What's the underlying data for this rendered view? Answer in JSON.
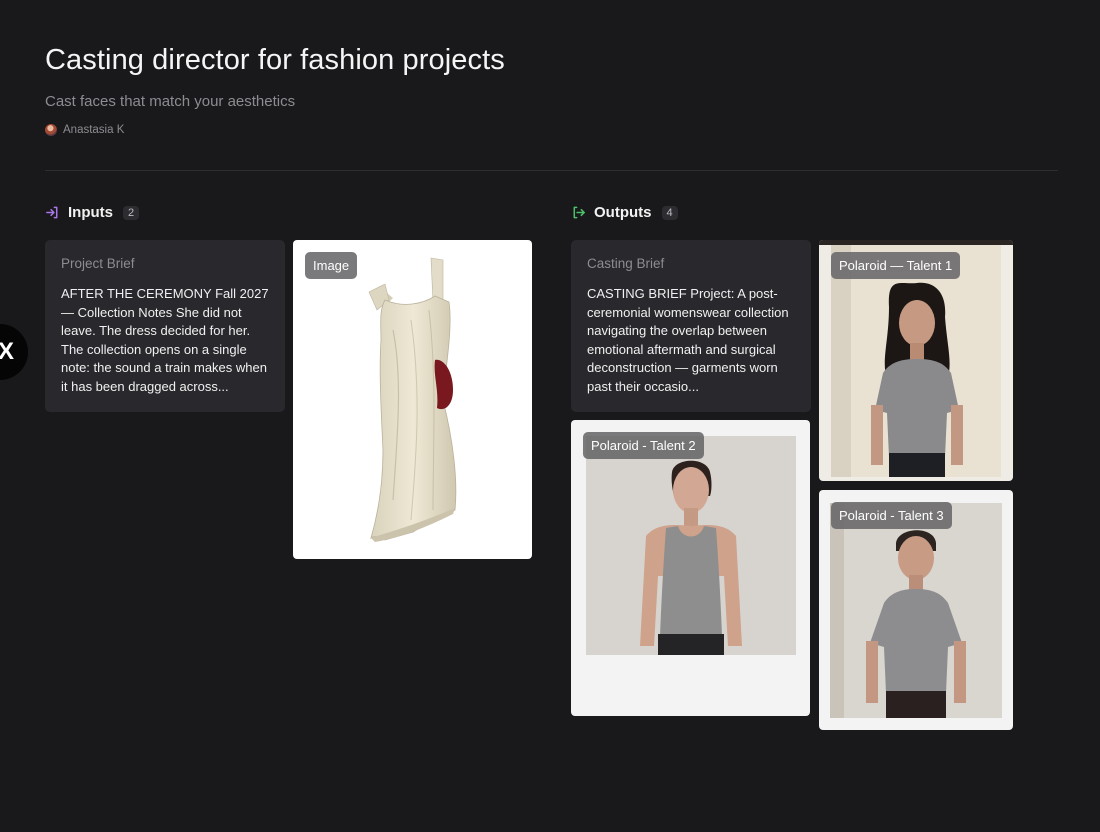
{
  "header": {
    "title": "Casting director for fashion projects",
    "subtitle": "Cast faces that match your aesthetics",
    "author": "Anastasia K"
  },
  "side_tab": {
    "glyph": "X"
  },
  "inputs": {
    "label": "Inputs",
    "count": "2",
    "icon": "login-arrow-icon",
    "icon_color": "#a978e8",
    "brief": {
      "label": "Project Brief",
      "text": "AFTER THE CEREMONY Fall 2027 — Collection Notes She did not leave. The dress decided for her. The collection opens on a single note: the sound a train makes when it has been dragged across..."
    },
    "image": {
      "label": "Image"
    }
  },
  "outputs": {
    "label": "Outputs",
    "count": "4",
    "icon": "logout-arrow-icon",
    "icon_color": "#4cc26a",
    "brief": {
      "label": "Casting Brief",
      "text": "CASTING BRIEF Project: A post-ceremonial womenswear collection navigating the overlap between emotional aftermath and surgical deconstruction — garments worn past their occasio..."
    },
    "talent1": {
      "label": "Polaroid — Talent 1"
    },
    "talent2": {
      "label": "Polaroid - Talent 2"
    },
    "talent3": {
      "label": "Polaroid - Talent 3"
    }
  }
}
